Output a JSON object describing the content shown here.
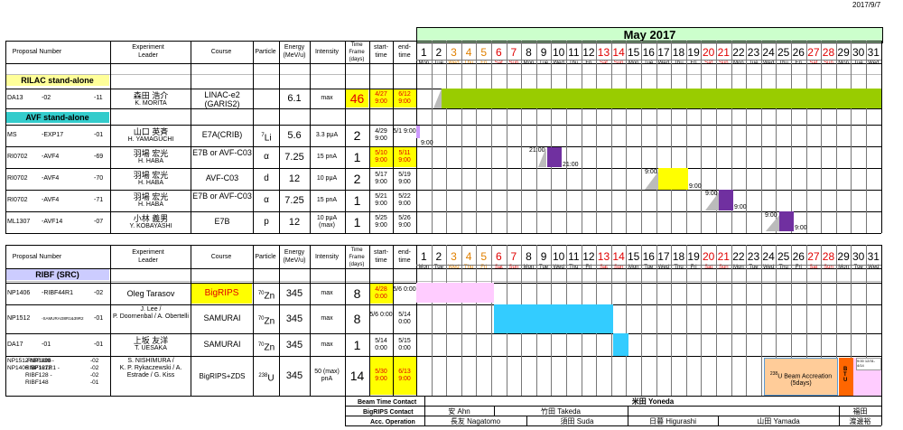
{
  "print_date": "2017/9/7",
  "month_title": "May 2017",
  "headers": {
    "proposal": "Proposal Number",
    "leader": [
      "Experiment",
      "Leader"
    ],
    "course": "Course",
    "particle": "Particle",
    "energy": [
      "Energy",
      "(MeV/u)"
    ],
    "intensity": "Intensity",
    "timeframe": [
      "Time",
      "Frame",
      "(days)"
    ],
    "start": [
      "start-",
      "time"
    ],
    "end": [
      "end-",
      "time"
    ]
  },
  "days": [
    {
      "n": "1",
      "w": "Mon",
      "k": "n"
    },
    {
      "n": "2",
      "w": "Tue",
      "k": "n"
    },
    {
      "n": "3",
      "w": "Wed",
      "k": "o"
    },
    {
      "n": "4",
      "w": "Thu",
      "k": "o"
    },
    {
      "n": "5",
      "w": "Fri",
      "k": "o"
    },
    {
      "n": "6",
      "w": "Sat",
      "k": "r"
    },
    {
      "n": "7",
      "w": "Sun",
      "k": "r"
    },
    {
      "n": "8",
      "w": "Mon",
      "k": "n"
    },
    {
      "n": "9",
      "w": "Tue",
      "k": "n"
    },
    {
      "n": "10",
      "w": "Wed",
      "k": "n"
    },
    {
      "n": "11",
      "w": "Thu",
      "k": "n"
    },
    {
      "n": "12",
      "w": "Fri",
      "k": "n"
    },
    {
      "n": "13",
      "w": "Sat",
      "k": "r"
    },
    {
      "n": "14",
      "w": "Sun",
      "k": "r"
    },
    {
      "n": "15",
      "w": "Mon",
      "k": "n"
    },
    {
      "n": "16",
      "w": "Tue",
      "k": "n"
    },
    {
      "n": "17",
      "w": "Wed",
      "k": "n"
    },
    {
      "n": "18",
      "w": "Thu",
      "k": "n"
    },
    {
      "n": "19",
      "w": "Fri",
      "k": "n"
    },
    {
      "n": "20",
      "w": "Sat",
      "k": "r"
    },
    {
      "n": "21",
      "w": "Sun",
      "k": "r"
    },
    {
      "n": "22",
      "w": "Mon",
      "k": "n"
    },
    {
      "n": "23",
      "w": "Tue",
      "k": "n"
    },
    {
      "n": "24",
      "w": "Wed",
      "k": "n"
    },
    {
      "n": "25",
      "w": "Thu",
      "k": "n"
    },
    {
      "n": "26",
      "w": "Fri",
      "k": "n"
    },
    {
      "n": "27",
      "w": "Sat",
      "k": "r"
    },
    {
      "n": "28",
      "w": "Sun",
      "k": "r"
    },
    {
      "n": "29",
      "w": "Mon",
      "k": "n"
    },
    {
      "n": "30",
      "w": "Tue",
      "k": "n"
    },
    {
      "n": "31",
      "w": "Wed",
      "k": "n"
    }
  ],
  "sections": {
    "rilac": "RILAC stand-alone",
    "avf": "AVF stand-alone",
    "ribf": "RIBF (SRC)"
  },
  "rows": [
    {
      "id": "rilac-da13",
      "p1": "DA13",
      "p2": "-02",
      "p3": "-11",
      "leader_jp": "森田 浩介",
      "leader_en": "K. MORITA",
      "course": "LINAC-e2 (GARIS2)",
      "particle_sup": "",
      "particle": "",
      "energy": "6.1",
      "intensity": "max",
      "days": "46",
      "start": "4/27 9:00",
      "end": "6/12 9:00"
    },
    {
      "id": "avf-ms",
      "p1": "MS",
      "p2": "-EXP17",
      "p3": "-01",
      "leader_jp": "山口 英斉",
      "leader_en": "H. YAMAGUCHI",
      "course": "E7A(CRIB)",
      "particle_sup": "7",
      "particle": "Li",
      "energy": "5.6",
      "intensity": "3.3 pμA",
      "days": "2",
      "start": "4/29 9:00",
      "end": "5/1 9:00"
    },
    {
      "id": "avf-ri0702-69",
      "p1": "RI0702",
      "p2": "-AVF4",
      "p3": "-69",
      "leader_jp": "羽場 宏光",
      "leader_en": "H. HABA",
      "course": "E7B or AVF-C03",
      "particle_sup": "",
      "particle": "α",
      "energy": "7.25",
      "intensity": "15 pnA",
      "days": "1",
      "start": "5/10 9:00",
      "end": "5/11 9:00"
    },
    {
      "id": "avf-ri0702-70",
      "p1": "RI0702",
      "p2": "-AVF4",
      "p3": "-70",
      "leader_jp": "羽場 宏光",
      "leader_en": "H. HABA",
      "course": "AVF-C03",
      "particle_sup": "",
      "particle": "d",
      "energy": "12",
      "intensity": "10 pμA",
      "days": "2",
      "start": "5/17 9:00",
      "end": "5/19 9:00"
    },
    {
      "id": "avf-ri0702-71",
      "p1": "RI0702",
      "p2": "-AVF4",
      "p3": "-71",
      "leader_jp": "羽場 宏光",
      "leader_en": "H. HABA",
      "course": "E7B or AVF-C03",
      "particle_sup": "",
      "particle": "α",
      "energy": "7.25",
      "intensity": "15 pnA",
      "days": "1",
      "start": "5/21 9:00",
      "end": "5/22 9:00"
    },
    {
      "id": "avf-ml1307",
      "p1": "ML1307",
      "p2": "-AVF14",
      "p3": "-07",
      "leader_jp": "小林 義男",
      "leader_en": "Y. KOBAYASHI",
      "course": "E7B",
      "particle_sup": "",
      "particle": "p",
      "energy": "12",
      "intensity": "10 pμA (max)",
      "days": "1",
      "start": "5/25 9:00",
      "end": "5/26 9:00"
    },
    {
      "id": "ribf-np1406",
      "p1": "NP1406",
      "p2": "-RIBF44R1",
      "p3": "-02",
      "leader_jp": "",
      "leader_en": "Oleg Tarasov",
      "course": "BigRIPS",
      "particle_sup": "70",
      "particle": "Zn",
      "energy": "345",
      "intensity": "max",
      "days": "8",
      "start": "4/28 0:00",
      "end": "5/6 0:00"
    },
    {
      "id": "ribf-np1512",
      "p1": "NP1512",
      "p2": "-SAMURAI38R1&39R2",
      "p3": "-01",
      "leader_jp": "J. Lee /",
      "leader_en": "P. Doornenbal / A. Obertelli",
      "course": "SAMURAI",
      "particle_sup": "70",
      "particle": "Zn",
      "energy": "345",
      "intensity": "max",
      "days": "8",
      "start": "5/6 0:00",
      "end": "5/14 0:00"
    },
    {
      "id": "ribf-da17",
      "p1": "DA17",
      "p2": "-01",
      "p3": "-01",
      "leader_jp": "上坂 友洋",
      "leader_en": "T. UESAKA",
      "course": "SAMURAI",
      "particle_sup": "70",
      "particle": "Zn",
      "energy": "345",
      "intensity": "max",
      "days": "1",
      "start": "5/14 0:00",
      "end": "5/15 0:00"
    },
    {
      "id": "ribf-multi",
      "p1": "NP1512 NP1406 NP1406 NP1612",
      "p2": "-RIBF139 -RIBF127R1 -RIBF128 -RIBF148",
      "p3": "-02 -02 -02 -01",
      "leader_jp": "S. NISHIMURA /",
      "leader_en": "K. P. Rykaczewski / A. Estrade / G. Kiss",
      "course": "BigRIPS+ZDS",
      "particle_sup": "238",
      "particle": "U",
      "energy": "345",
      "intensity": "50 (max) pnA",
      "days": "14",
      "start": "5/30 9:00",
      "end": "6/13 9:00"
    }
  ],
  "bar_labels": {
    "ms_end": "9:00",
    "ri69_start": "21:00",
    "ri69_end": "21:00",
    "ri70_start": "9:00",
    "ri70_end": "9:00",
    "ri71_start": "9:00",
    "ri71_end": "9:00",
    "ml_start": "9:00",
    "ml_end": "9:00",
    "u_accel_sup": "238",
    "u_accel": "U Beam Accreation (5days)",
    "btu": "BTU",
    "fukuda_note": "9:00 12/31- 4/14"
  },
  "contacts": {
    "bt_label": "Beam Time Contact",
    "bt_name": "米田 Yoneda",
    "br_label": "BigRIPS Contact",
    "br_names": [
      "安 Ahn",
      "竹田 Takeda",
      "福田"
    ],
    "acc_label": "Acc. Operation",
    "acc_names": [
      "長友 Nagatomo",
      "須田 Suda",
      "日暮 Higurashi",
      "山田 Yamada",
      "渡邊裕"
    ]
  }
}
